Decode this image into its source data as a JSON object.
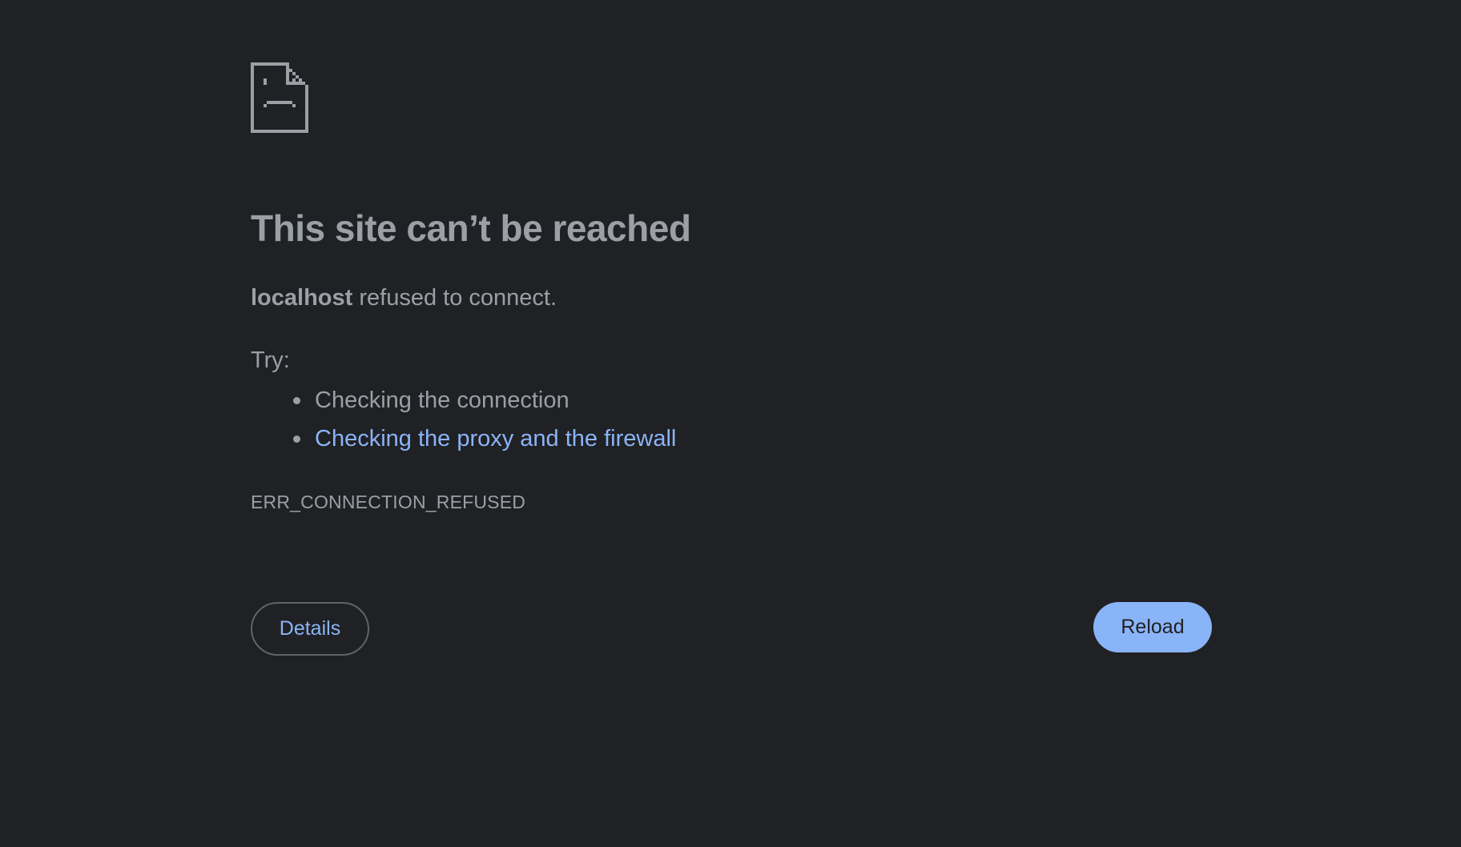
{
  "error_page": {
    "icon": "sad-document-icon",
    "title": "This site can’t be reached",
    "host": "localhost",
    "summary_suffix": " refused to connect.",
    "try_label": "Try:",
    "suggestions": [
      {
        "text": "Checking the connection",
        "is_link": false
      },
      {
        "text": "Checking the proxy and the firewall",
        "is_link": true
      }
    ],
    "error_code": "ERR_CONNECTION_REFUSED",
    "details_label": "Details",
    "reload_label": "Reload"
  },
  "colors": {
    "background": "#202124",
    "text": "#9aa0a6",
    "link": "#8ab4f8",
    "button_primary": "#8ab4f8",
    "button_outline": "#5f6368"
  }
}
